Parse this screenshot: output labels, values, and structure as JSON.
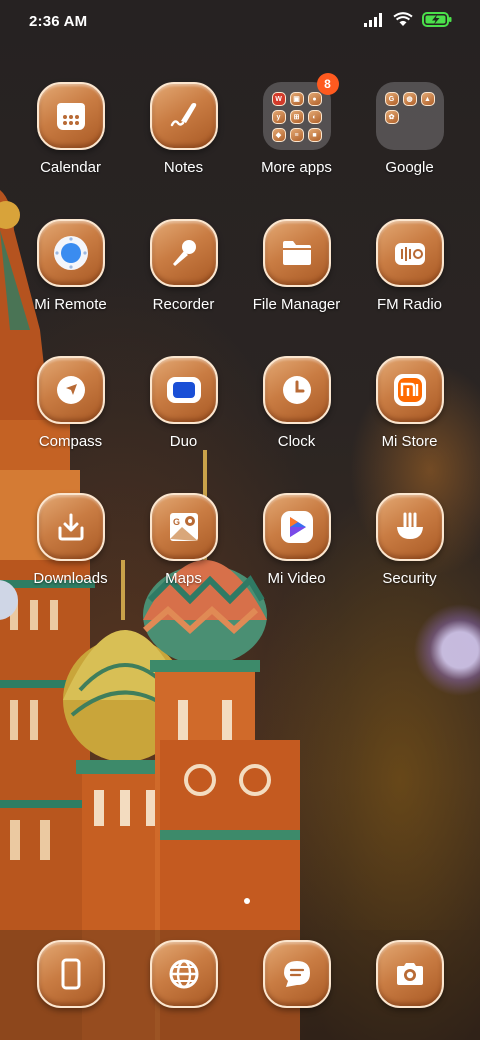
{
  "status_bar": {
    "time": "2:36 AM",
    "icons": [
      "signal-icon",
      "wifi-icon",
      "battery-charging-icon"
    ]
  },
  "apps": [
    {
      "label": "Calendar",
      "icon": "calendar-icon"
    },
    {
      "label": "Notes",
      "icon": "pen-icon"
    },
    {
      "label": "More apps",
      "icon": "folder-icon",
      "badge": "8"
    },
    {
      "label": "Google",
      "icon": "folder-icon"
    },
    {
      "label": "Mi Remote",
      "icon": "remote-icon"
    },
    {
      "label": "Recorder",
      "icon": "microphone-icon"
    },
    {
      "label": "File Manager",
      "icon": "file-folder-icon"
    },
    {
      "label": "FM Radio",
      "icon": "radio-icon"
    },
    {
      "label": "Compass",
      "icon": "compass-icon"
    },
    {
      "label": "Duo",
      "icon": "video-camera-icon"
    },
    {
      "label": "Clock",
      "icon": "clock-icon"
    },
    {
      "label": "Mi Store",
      "icon": "mi-logo-icon"
    },
    {
      "label": "Downloads",
      "icon": "download-icon"
    },
    {
      "label": "Maps",
      "icon": "map-icon"
    },
    {
      "label": "Mi Video",
      "icon": "play-icon"
    },
    {
      "label": "Security",
      "icon": "shield-broom-icon"
    }
  ],
  "dock": [
    {
      "name": "phone",
      "icon": "phone-icon"
    },
    {
      "name": "browser",
      "icon": "globe-icon"
    },
    {
      "name": "messages",
      "icon": "message-icon"
    },
    {
      "name": "camera",
      "icon": "camera-icon"
    }
  ],
  "theme": {
    "icon_gradient": [
      "#e3a873",
      "#a95a25"
    ],
    "icon_border": "#fbe6cf",
    "badge_color": "#ff5a1f"
  }
}
